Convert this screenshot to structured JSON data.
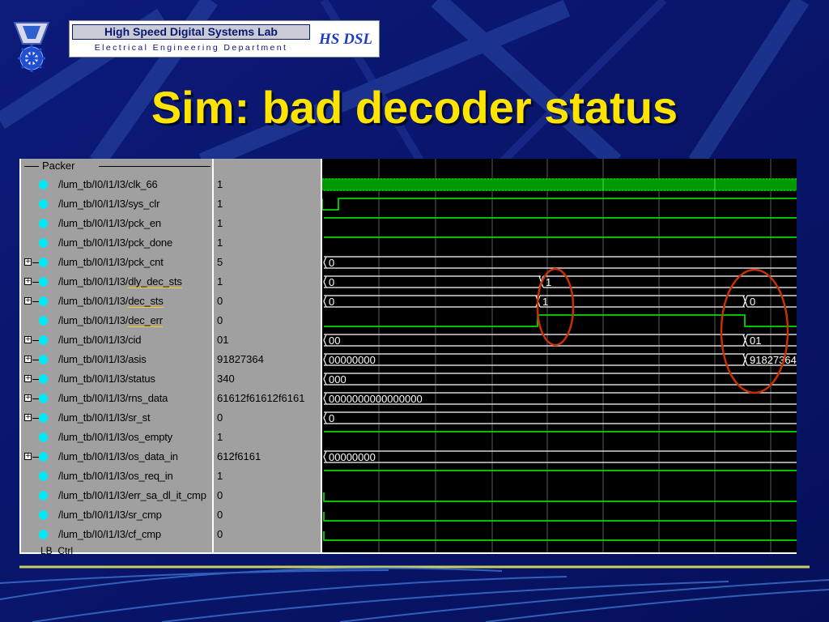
{
  "header": {
    "lab_name": "High Speed Digital Systems Lab",
    "department": "Electrical Engineering Department",
    "lab_abbrev": "HS DSL",
    "emblem_icon": "technion-emblem-icon"
  },
  "title": "Sim: bad decoder status",
  "colors": {
    "background": "#0a1670",
    "title": "#ffe400",
    "wave": "#00ff00",
    "bus": "#ffffff",
    "marker_circle": "#c83000",
    "signal_dot": "#00e8f8"
  },
  "wave_viewer": {
    "group_name": "Packer",
    "next_group_name": "LB_Ctrl",
    "signals": [
      {
        "name": "/lum_tb/I0/I1/I3/clk_66",
        "value": "1",
        "expandable": false,
        "underline": false,
        "kind": "clock",
        "labels": []
      },
      {
        "name": "/lum_tb/I0/I1/I3/sys_clr",
        "value": "1",
        "expandable": false,
        "underline": false,
        "kind": "pulse",
        "labels": []
      },
      {
        "name": "/lum_tb/I0/I1/I3/pck_en",
        "value": "1",
        "expandable": false,
        "underline": false,
        "kind": "high",
        "labels": []
      },
      {
        "name": "/lum_tb/I0/I1/I3/pck_done",
        "value": "1",
        "expandable": false,
        "underline": false,
        "kind": "high",
        "labels": []
      },
      {
        "name": "/lum_tb/I0/I1/I3/pck_cnt",
        "value": "5",
        "expandable": true,
        "underline": false,
        "kind": "bus",
        "labels": [
          "0"
        ]
      },
      {
        "name": "/lum_tb/I0/I1/I3/dly_dec_sts",
        "value": "1",
        "expandable": true,
        "underline": true,
        "kind": "bus",
        "labels": [
          "0",
          "1"
        ]
      },
      {
        "name": "/lum_tb/I0/I1/I3/dec_sts",
        "value": "0",
        "expandable": true,
        "underline": true,
        "kind": "bus",
        "labels": [
          "0",
          "1",
          "0"
        ]
      },
      {
        "name": "/lum_tb/I0/I1/I3/dec_err",
        "value": "0",
        "expandable": false,
        "underline": true,
        "kind": "err",
        "labels": []
      },
      {
        "name": "/lum_tb/I0/I1/I3/cid",
        "value": "01",
        "expandable": true,
        "underline": false,
        "kind": "bus",
        "labels": [
          "00",
          "01"
        ]
      },
      {
        "name": "/lum_tb/I0/I1/I3/asis",
        "value": "91827364",
        "expandable": true,
        "underline": false,
        "kind": "bus",
        "labels": [
          "00000000",
          "91827364"
        ]
      },
      {
        "name": "/lum_tb/I0/I1/I3/status",
        "value": "340",
        "expandable": true,
        "underline": false,
        "kind": "bus",
        "labels": [
          "000"
        ]
      },
      {
        "name": "/lum_tb/I0/I1/I3/rns_data",
        "value": "61612f61612f6161",
        "expandable": true,
        "underline": false,
        "kind": "bus",
        "labels": [
          "0000000000000000"
        ]
      },
      {
        "name": "/lum_tb/I0/I1/I3/sr_st",
        "value": "0",
        "expandable": true,
        "underline": false,
        "kind": "bus",
        "labels": [
          "0"
        ]
      },
      {
        "name": "/lum_tb/I0/I1/I3/os_empty",
        "value": "1",
        "expandable": false,
        "underline": false,
        "kind": "high",
        "labels": []
      },
      {
        "name": "/lum_tb/I0/I1/I3/os_data_in",
        "value": "612f6161",
        "expandable": true,
        "underline": false,
        "kind": "bus",
        "labels": [
          "00000000"
        ]
      },
      {
        "name": "/lum_tb/I0/I1/I3/os_req_in",
        "value": "1",
        "expandable": false,
        "underline": false,
        "kind": "high",
        "labels": []
      },
      {
        "name": "/lum_tb/I0/I1/I3/err_sa_dl_it_cmp",
        "value": "0",
        "expandable": false,
        "underline": false,
        "kind": "low",
        "labels": []
      },
      {
        "name": "/lum_tb/I0/I1/I3/sr_cmp",
        "value": "0",
        "expandable": false,
        "underline": false,
        "kind": "low",
        "labels": []
      },
      {
        "name": "/lum_tb/I0/I1/I3/cf_cmp",
        "value": "0",
        "expandable": false,
        "underline": false,
        "kind": "low",
        "labels": []
      }
    ]
  }
}
